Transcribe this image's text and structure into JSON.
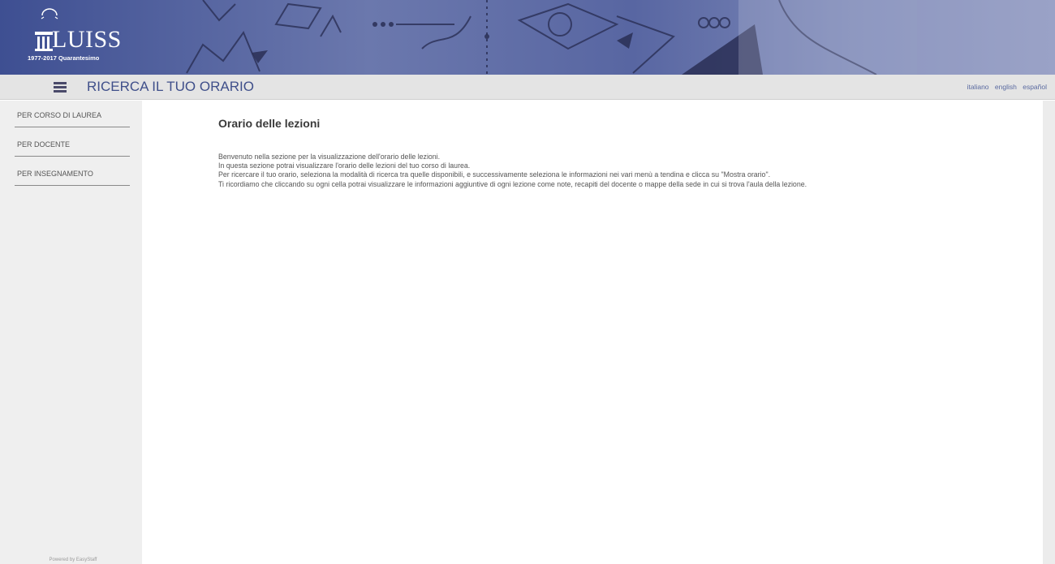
{
  "banner": {
    "logo_badge": "40",
    "logo_name": "LUISS",
    "logo_subtitle": "1977-2017 Quarantesimo"
  },
  "header": {
    "title": "RICERCA IL TUO ORARIO",
    "languages": [
      "italiano",
      "english",
      "español"
    ]
  },
  "sidebar": {
    "items": [
      {
        "label": "PER CORSO DI LAUREA"
      },
      {
        "label": "PER DOCENTE"
      },
      {
        "label": "PER INSEGNAMENTO"
      }
    ],
    "footer": "Powered by EasyStaff"
  },
  "main": {
    "heading": "Orario delle lezioni",
    "paragraphs": [
      "Benvenuto nella sezione per la visualizzazione dell'orario delle lezioni.",
      "In questa sezione potrai visualizzare l'orario delle lezioni del tuo corso di laurea.",
      "Per ricercare il tuo orario, seleziona la modalità di ricerca tra quelle disponibili, e successivamente seleziona le informazioni nei vari menù a tendina e clicca su \"Mostra orario\".",
      "Ti ricordiamo che cliccando su ogni cella potrai visualizzare le informazioni aggiuntive di ogni lezione come note, recapiti del docente o mappe della sede in cui si trova l'aula della lezione."
    ]
  },
  "colors": {
    "banner_blue": "#4a5a9a",
    "title_blue": "#3f4f8a",
    "sidebar_bg": "#efefef",
    "titlebar_bg": "#e4e4e4"
  }
}
